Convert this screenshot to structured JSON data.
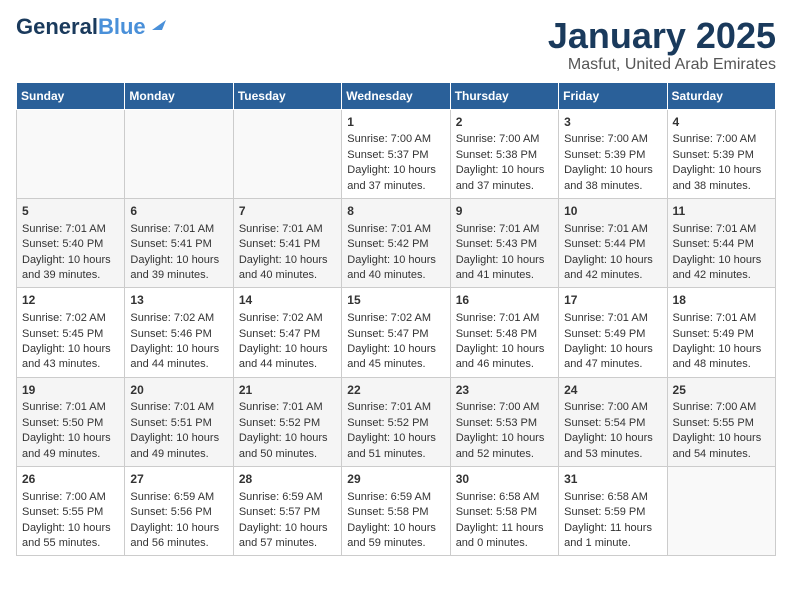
{
  "header": {
    "logo_line1": "General",
    "logo_line2": "Blue",
    "title": "January 2025",
    "subtitle": "Masfut, United Arab Emirates"
  },
  "days_of_week": [
    "Sunday",
    "Monday",
    "Tuesday",
    "Wednesday",
    "Thursday",
    "Friday",
    "Saturday"
  ],
  "weeks": [
    [
      {
        "day": "",
        "info": ""
      },
      {
        "day": "",
        "info": ""
      },
      {
        "day": "",
        "info": ""
      },
      {
        "day": "1",
        "info": "Sunrise: 7:00 AM\nSunset: 5:37 PM\nDaylight: 10 hours and 37 minutes."
      },
      {
        "day": "2",
        "info": "Sunrise: 7:00 AM\nSunset: 5:38 PM\nDaylight: 10 hours and 37 minutes."
      },
      {
        "day": "3",
        "info": "Sunrise: 7:00 AM\nSunset: 5:39 PM\nDaylight: 10 hours and 38 minutes."
      },
      {
        "day": "4",
        "info": "Sunrise: 7:00 AM\nSunset: 5:39 PM\nDaylight: 10 hours and 38 minutes."
      }
    ],
    [
      {
        "day": "5",
        "info": "Sunrise: 7:01 AM\nSunset: 5:40 PM\nDaylight: 10 hours and 39 minutes."
      },
      {
        "day": "6",
        "info": "Sunrise: 7:01 AM\nSunset: 5:41 PM\nDaylight: 10 hours and 39 minutes."
      },
      {
        "day": "7",
        "info": "Sunrise: 7:01 AM\nSunset: 5:41 PM\nDaylight: 10 hours and 40 minutes."
      },
      {
        "day": "8",
        "info": "Sunrise: 7:01 AM\nSunset: 5:42 PM\nDaylight: 10 hours and 40 minutes."
      },
      {
        "day": "9",
        "info": "Sunrise: 7:01 AM\nSunset: 5:43 PM\nDaylight: 10 hours and 41 minutes."
      },
      {
        "day": "10",
        "info": "Sunrise: 7:01 AM\nSunset: 5:44 PM\nDaylight: 10 hours and 42 minutes."
      },
      {
        "day": "11",
        "info": "Sunrise: 7:01 AM\nSunset: 5:44 PM\nDaylight: 10 hours and 42 minutes."
      }
    ],
    [
      {
        "day": "12",
        "info": "Sunrise: 7:02 AM\nSunset: 5:45 PM\nDaylight: 10 hours and 43 minutes."
      },
      {
        "day": "13",
        "info": "Sunrise: 7:02 AM\nSunset: 5:46 PM\nDaylight: 10 hours and 44 minutes."
      },
      {
        "day": "14",
        "info": "Sunrise: 7:02 AM\nSunset: 5:47 PM\nDaylight: 10 hours and 44 minutes."
      },
      {
        "day": "15",
        "info": "Sunrise: 7:02 AM\nSunset: 5:47 PM\nDaylight: 10 hours and 45 minutes."
      },
      {
        "day": "16",
        "info": "Sunrise: 7:01 AM\nSunset: 5:48 PM\nDaylight: 10 hours and 46 minutes."
      },
      {
        "day": "17",
        "info": "Sunrise: 7:01 AM\nSunset: 5:49 PM\nDaylight: 10 hours and 47 minutes."
      },
      {
        "day": "18",
        "info": "Sunrise: 7:01 AM\nSunset: 5:49 PM\nDaylight: 10 hours and 48 minutes."
      }
    ],
    [
      {
        "day": "19",
        "info": "Sunrise: 7:01 AM\nSunset: 5:50 PM\nDaylight: 10 hours and 49 minutes."
      },
      {
        "day": "20",
        "info": "Sunrise: 7:01 AM\nSunset: 5:51 PM\nDaylight: 10 hours and 49 minutes."
      },
      {
        "day": "21",
        "info": "Sunrise: 7:01 AM\nSunset: 5:52 PM\nDaylight: 10 hours and 50 minutes."
      },
      {
        "day": "22",
        "info": "Sunrise: 7:01 AM\nSunset: 5:52 PM\nDaylight: 10 hours and 51 minutes."
      },
      {
        "day": "23",
        "info": "Sunrise: 7:00 AM\nSunset: 5:53 PM\nDaylight: 10 hours and 52 minutes."
      },
      {
        "day": "24",
        "info": "Sunrise: 7:00 AM\nSunset: 5:54 PM\nDaylight: 10 hours and 53 minutes."
      },
      {
        "day": "25",
        "info": "Sunrise: 7:00 AM\nSunset: 5:55 PM\nDaylight: 10 hours and 54 minutes."
      }
    ],
    [
      {
        "day": "26",
        "info": "Sunrise: 7:00 AM\nSunset: 5:55 PM\nDaylight: 10 hours and 55 minutes."
      },
      {
        "day": "27",
        "info": "Sunrise: 6:59 AM\nSunset: 5:56 PM\nDaylight: 10 hours and 56 minutes."
      },
      {
        "day": "28",
        "info": "Sunrise: 6:59 AM\nSunset: 5:57 PM\nDaylight: 10 hours and 57 minutes."
      },
      {
        "day": "29",
        "info": "Sunrise: 6:59 AM\nSunset: 5:58 PM\nDaylight: 10 hours and 59 minutes."
      },
      {
        "day": "30",
        "info": "Sunrise: 6:58 AM\nSunset: 5:58 PM\nDaylight: 11 hours and 0 minutes."
      },
      {
        "day": "31",
        "info": "Sunrise: 6:58 AM\nSunset: 5:59 PM\nDaylight: 11 hours and 1 minute."
      },
      {
        "day": "",
        "info": ""
      }
    ]
  ]
}
